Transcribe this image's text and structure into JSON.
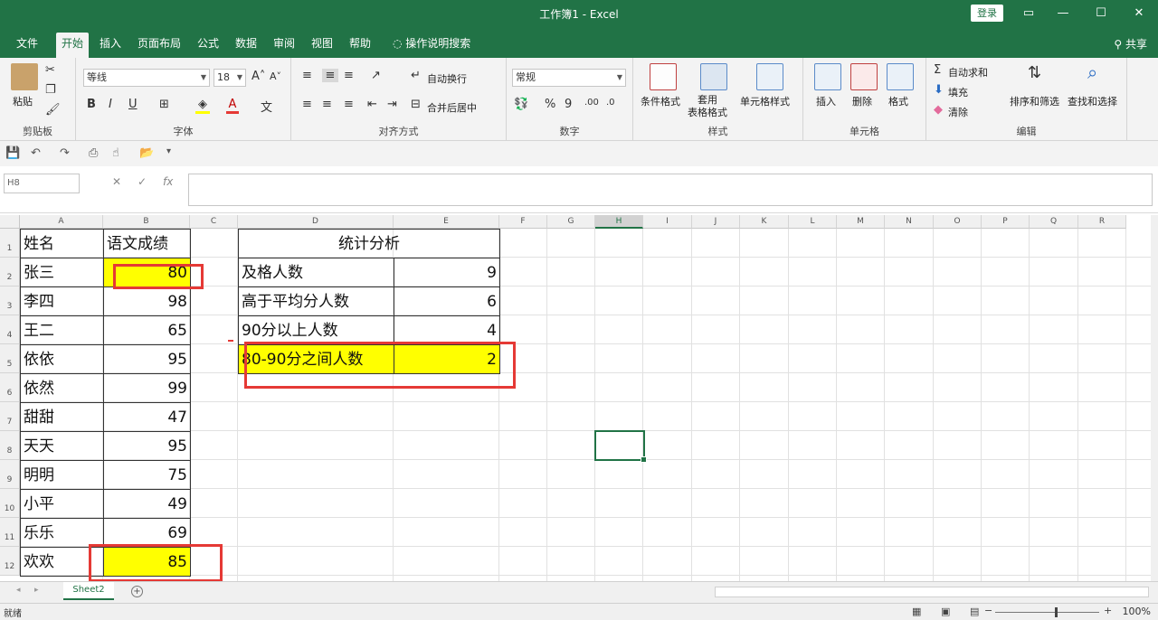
{
  "window": {
    "title": "工作簿1 - Excel",
    "login_label": "登录",
    "controls": [
      "▭",
      "—",
      "☐",
      "✕"
    ]
  },
  "ribbon_tabs": [
    "文件",
    "开始",
    "插入",
    "页面布局",
    "公式",
    "数据",
    "审阅",
    "视图",
    "帮助",
    "操作说明搜索"
  ],
  "active_tab": "开始",
  "share_label": "共享",
  "ribbon": {
    "clipboard": {
      "paste": "粘贴",
      "label": "剪贴板"
    },
    "font": {
      "name": "等线",
      "size": "18",
      "label": "字体",
      "bold": "B",
      "italic": "I",
      "underline": "U"
    },
    "alignment": {
      "wrap": "自动换行",
      "merge": "合并后居中",
      "label": "对齐方式"
    },
    "number": {
      "format": "常规",
      "percent": "%",
      "comma": "9",
      "label": "数字"
    },
    "styles": {
      "conditional": "条件格式",
      "table": "套用\n表格格式",
      "cell_styles": "单元格样式",
      "label": "样式"
    },
    "cells": {
      "insert": "插入",
      "delete": "删除",
      "format": "格式",
      "label": "单元格"
    },
    "editing": {
      "autosum": "自动求和",
      "fill": "填充",
      "clear": "清除",
      "sort": "排序和筛选",
      "find": "查找和选择",
      "label": "编辑"
    }
  },
  "name_box": "H8",
  "formula_icons": {
    "cancel": "✕",
    "enter": "✓",
    "fx": "fx"
  },
  "columns": [
    "A",
    "B",
    "C",
    "D",
    "E",
    "F",
    "G",
    "H",
    "I",
    "J",
    "K",
    "L",
    "M",
    "N",
    "O",
    "P",
    "Q",
    "R"
  ],
  "selected_column": "H",
  "rows": [
    "1",
    "2",
    "3",
    "4",
    "5",
    "6",
    "7",
    "8",
    "9",
    "10",
    "11",
    "12"
  ],
  "sheet": {
    "header_name": "姓名",
    "header_score": "语文成绩",
    "students": [
      {
        "name": "张三",
        "score": "80"
      },
      {
        "name": "李四",
        "score": "98"
      },
      {
        "name": "王二",
        "score": "65"
      },
      {
        "name": "依依",
        "score": "95"
      },
      {
        "name": "依然",
        "score": "99"
      },
      {
        "name": "甜甜",
        "score": "47"
      },
      {
        "name": "天天",
        "score": "95"
      },
      {
        "name": "明明",
        "score": "75"
      },
      {
        "name": "小平",
        "score": "49"
      },
      {
        "name": "乐乐",
        "score": "69"
      },
      {
        "name": "欢欢",
        "score": "85"
      }
    ],
    "stats_title": "统计分析",
    "stats": [
      {
        "label": "及格人数",
        "value": "9"
      },
      {
        "label": "高于平均分人数",
        "value": "6"
      },
      {
        "label": "90分以上人数",
        "value": "4"
      },
      {
        "label": "80-90分之间人数",
        "value": "2"
      }
    ]
  },
  "sheet_tab": "Sheet2",
  "add_sheet": "+",
  "status": "就绪",
  "zoom": "100%",
  "colors": {
    "accent": "#217346",
    "highlight": "#ffff00",
    "annotation": "#e53935"
  }
}
